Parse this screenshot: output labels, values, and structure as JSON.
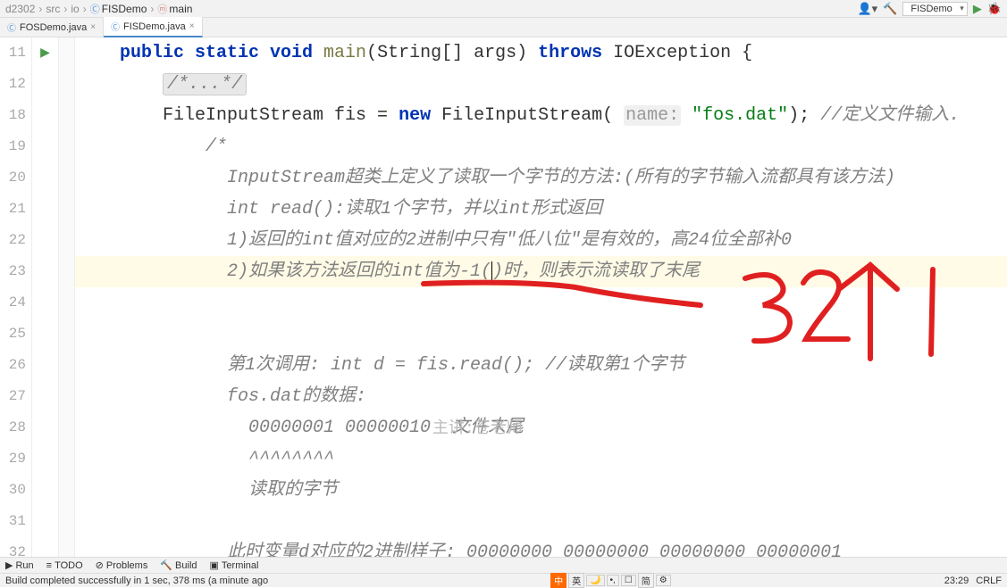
{
  "breadcrumb": {
    "items": [
      "d2302",
      "src",
      "io",
      "FISDemo",
      "main"
    ],
    "types": [
      "pkg",
      "pkg",
      "pkg",
      "cls",
      "method"
    ]
  },
  "toolbar": {
    "run_config": "FISDemo"
  },
  "tabs": [
    {
      "label": "FOSDemo.java",
      "active": false
    },
    {
      "label": "FISDemo.java",
      "active": true
    }
  ],
  "gutter_lines": [
    "11",
    "12",
    "18",
    "19",
    "20",
    "21",
    "22",
    "23",
    "24",
    "25",
    "26",
    "27",
    "28",
    "29",
    "30",
    "31",
    "32"
  ],
  "code": {
    "l11": {
      "pre": "",
      "seg": [
        {
          "t": "    ",
          "c": ""
        },
        {
          "t": "public static void ",
          "c": "kw"
        },
        {
          "t": "main",
          "c": "mname"
        },
        {
          "t": "(String[] args) ",
          "c": ""
        },
        {
          "t": "throws ",
          "c": "kw"
        },
        {
          "t": "IOException {",
          "c": ""
        }
      ]
    },
    "l12_fold": "/*...*/",
    "l18": {
      "seg": [
        {
          "t": "        FileInputStream fis = ",
          "c": ""
        },
        {
          "t": "new ",
          "c": "kw"
        },
        {
          "t": "FileInputStream( ",
          "c": ""
        },
        {
          "t": "name:",
          "c": "param-hint"
        },
        {
          "t": " ",
          "c": ""
        },
        {
          "t": "\"fos.dat\"",
          "c": "str"
        },
        {
          "t": "); ",
          "c": ""
        },
        {
          "t": "//定义文件输入.",
          "c": "cmt"
        }
      ]
    },
    "l19": "        /*",
    "l20": "          InputStream超类上定义了读取一个字节的方法:(所有的字节输入流都具有该方法)",
    "l21": "          int read():读取1个字节，并以int形式返回",
    "l22": "          1)返回的int值对应的2进制中只有\"低八位\"是有效的，高24位全部补0",
    "l23_a": "          2)如果该方法返回的int值为-1(",
    "l23_b": ")时，则表示流读取了末尾",
    "l26": "          第1次调用: int d = fis.read(); //读取第1个字节",
    "l27": "          fos.dat的数据:",
    "l28": "            00000001 00000010  文件末尾",
    "l29": "            ^^^^^^^^",
    "l30": "            读取的字节",
    "l32": "          此时变量d对应的2进制样子: 00000000 00000000 00000000 00000001"
  },
  "bottom_bar": {
    "run": "Run",
    "todo": "TODO",
    "problems": "Problems",
    "build": "Build",
    "terminal": "Terminal"
  },
  "status": {
    "msg": "Build completed successfully in 1 sec, 378 ms (a minute ago",
    "ime": [
      "中",
      "英",
      "",
      "",
      "简"
    ],
    "cursor": "23:29",
    "encoding": "CRLF"
  },
  "watermark": "主讲:苍老师",
  "annotation_text": "32个1"
}
